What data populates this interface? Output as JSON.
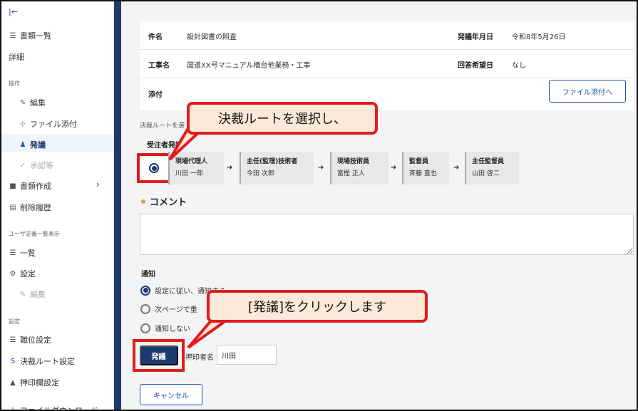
{
  "sidebar": {
    "items": [
      {
        "label": "書類一覧",
        "icon": "list-icon"
      },
      {
        "label": "詳細"
      },
      {
        "label": "編集",
        "icon": "pencil-icon"
      },
      {
        "label": "ファイル添付",
        "icon": "paperclip-icon"
      },
      {
        "label": "発議",
        "icon": "users-icon"
      },
      {
        "label": "承認等",
        "icon": "check-circle-icon"
      },
      {
        "label": "書類作成",
        "icon": "document-icon"
      },
      {
        "label": "削除履歴",
        "icon": "trash-icon"
      },
      {
        "label": "一覧",
        "icon": "list-icon"
      },
      {
        "label": "設定",
        "icon": "gear-icon"
      },
      {
        "label": "編集",
        "icon": "pencil-icon"
      },
      {
        "label": "職位設定",
        "icon": "layers-icon"
      },
      {
        "label": "決裁ルート設定",
        "icon": "route-icon"
      },
      {
        "label": "押印欄設定",
        "icon": "stamp-icon"
      },
      {
        "label": "ファイルダウンロード",
        "icon": "download-icon"
      }
    ],
    "headers": [
      "操作",
      "ユーザ定義一覧表示",
      "設定"
    ]
  },
  "info": {
    "subject_label": "件名",
    "subject_value": "設計図書の照査",
    "date_label": "発議年月日",
    "date_value": "令和8年5月26日",
    "project_label": "工事名",
    "project_value": "国道XX号マニュアル橋台他業務・工事",
    "reply_label": "回答希望日",
    "reply_value": "なし",
    "attach_label": "添付",
    "attach_button": "ファイル添付へ"
  },
  "route": {
    "label": "決裁ルートを選",
    "sub_label": "受注者発議",
    "steps": [
      {
        "title": "現場代理人",
        "name": "川田 一郎"
      },
      {
        "title": "主任(監理)技術者",
        "name": "今田 次郎"
      },
      {
        "title": "現場技術員",
        "name": "富樫 正人"
      },
      {
        "title": "監督員",
        "name": "斉藤 直也"
      },
      {
        "title": "主任監督員",
        "name": "山田 啓二"
      }
    ]
  },
  "comment": {
    "heading": "コメント"
  },
  "notify": {
    "heading": "通知",
    "options": [
      "設定に従い、通知する",
      "次ページで重",
      "通知しない"
    ]
  },
  "actions": {
    "issue": "発議",
    "stamp_label": "押印者名",
    "stamp_value": "川田",
    "cancel": "キャンセル"
  },
  "callouts": {
    "top": "決裁ルートを選択し、",
    "bottom": "[発議]をクリックします"
  },
  "colors": {
    "navy": "#1d3a6e",
    "accent": "#1d4fa8",
    "callout_border": "#e21b1b",
    "callout_fill": "#fde9d9"
  }
}
